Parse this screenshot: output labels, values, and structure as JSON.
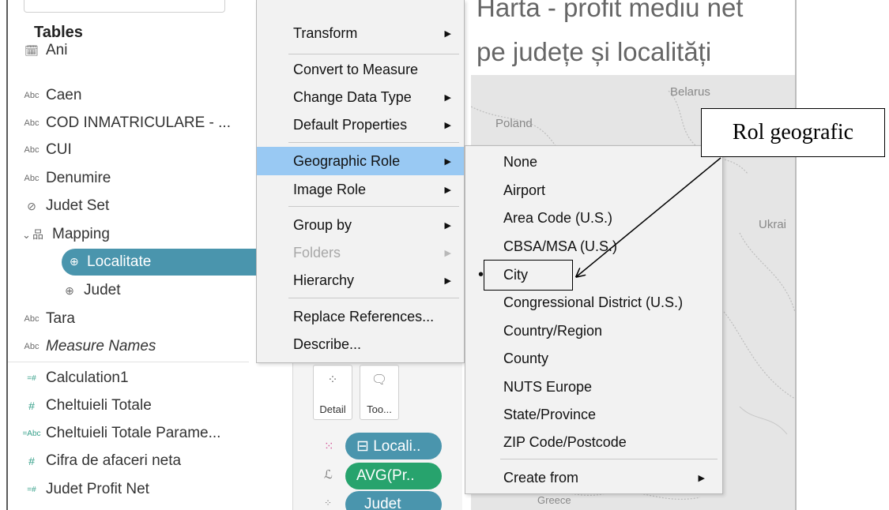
{
  "data_pane": {
    "tables_title": "Tables",
    "fields": [
      {
        "icon": "calendar-icon",
        "glyph": "🗓",
        "label": "Ani"
      },
      {
        "icon": "abc-icon",
        "glyph": "Abc",
        "label": "Caen"
      },
      {
        "icon": "abc-icon",
        "glyph": "Abc",
        "label": "COD INMATRICULARE - ..."
      },
      {
        "icon": "abc-icon",
        "glyph": "Abc",
        "label": "CUI"
      },
      {
        "icon": "abc-icon",
        "glyph": "Abc",
        "label": "Denumire"
      },
      {
        "icon": "set-icon",
        "glyph": "⊘",
        "label": "Judet Set"
      },
      {
        "icon": "hierarchy-icon",
        "glyph": "品",
        "label": "Mapping"
      },
      {
        "icon": "globe-icon",
        "glyph": "⊕",
        "label": "Localitate"
      },
      {
        "icon": "globe-icon",
        "glyph": "⊕",
        "label": "Judet"
      },
      {
        "icon": "abc-icon",
        "glyph": "Abc",
        "label": "Tara"
      },
      {
        "icon": "abc-icon",
        "glyph": "Abc",
        "label": "Measure Names"
      },
      {
        "icon": "calc-measure-icon",
        "glyph": "=#",
        "label": "Calculation1"
      },
      {
        "icon": "measure-icon",
        "glyph": "#",
        "label": "Cheltuieli Totale"
      },
      {
        "icon": "calc-abc-icon",
        "glyph": "=Abc",
        "label": "Cheltuieli Totale Parame..."
      },
      {
        "icon": "measure-icon",
        "glyph": "#",
        "label": "Cifra de afaceri neta"
      },
      {
        "icon": "calc-measure-icon",
        "glyph": "=#",
        "label": "Judet Profit Net"
      }
    ]
  },
  "marks": {
    "detail_label": "Detail",
    "tooltip_label": "Too...",
    "pills": [
      "⊟ Locali..",
      "AVG(Pr..",
      "Judet"
    ]
  },
  "map": {
    "title_line1": "Harta - profit mediu net",
    "title_line2": "pe județe și localități",
    "labels": [
      "Belarus",
      "Poland",
      "Ukrai",
      "Greece"
    ]
  },
  "context_menu": {
    "items": [
      "Transform",
      "Convert to Measure",
      "Change Data Type",
      "Default Properties",
      "Geographic Role",
      "Image Role",
      "Group by",
      "Folders",
      "Hierarchy",
      "Replace References...",
      "Describe..."
    ]
  },
  "geo_submenu": {
    "items": [
      "None",
      "Airport",
      "Area Code (U.S.)",
      "CBSA/MSA (U.S.)",
      "City",
      "Congressional District (U.S.)",
      "Country/Region",
      "County",
      "NUTS Europe",
      "State/Province",
      "ZIP Code/Postcode",
      "Create from"
    ],
    "bullet": "•"
  },
  "annotation": {
    "callout_text": "Rol geografic"
  },
  "colors": {
    "selected_pill": "#4a95ad",
    "dimension_pill": "#4a95ad",
    "measure_pill": "#27a36d",
    "menu_highlight": "#99c9f3",
    "measure_icon": "#36a08a"
  }
}
